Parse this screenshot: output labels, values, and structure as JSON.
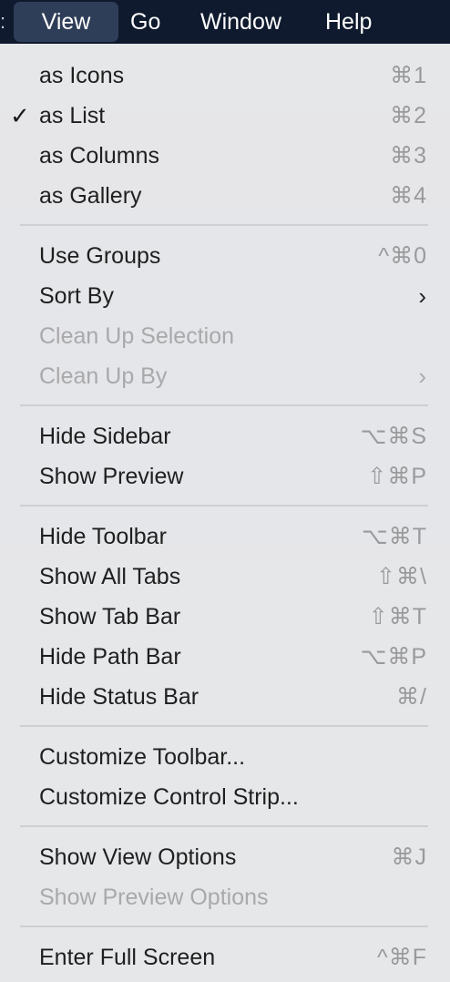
{
  "menubar": {
    "edge_glyph": ":",
    "items": [
      "View",
      "Go",
      "Window",
      "Help"
    ]
  },
  "menu": {
    "items": [
      {
        "label": "as Icons",
        "shortcut": "⌘1",
        "checked": false
      },
      {
        "label": "as List",
        "shortcut": "⌘2",
        "checked": true
      },
      {
        "label": "as Columns",
        "shortcut": "⌘3",
        "checked": false
      },
      {
        "label": "as Gallery",
        "shortcut": "⌘4",
        "checked": false
      },
      {
        "label": "Use Groups",
        "shortcut": "^⌘0"
      },
      {
        "label": "Sort By",
        "submenu": "›"
      },
      {
        "label": "Clean Up Selection",
        "disabled": true
      },
      {
        "label": "Clean Up By",
        "submenu": "›",
        "disabled": true
      },
      {
        "label": "Hide Sidebar",
        "shortcut": "⌥⌘S"
      },
      {
        "label": "Show Preview",
        "shortcut": "⇧⌘P"
      },
      {
        "label": "Hide Toolbar",
        "shortcut": "⌥⌘T"
      },
      {
        "label": "Show All Tabs",
        "shortcut": "⇧⌘\\"
      },
      {
        "label": "Show Tab Bar",
        "shortcut": "⇧⌘T"
      },
      {
        "label": "Hide Path Bar",
        "shortcut": "⌥⌘P"
      },
      {
        "label": "Hide Status Bar",
        "shortcut": "⌘/"
      },
      {
        "label": "Customize Toolbar..."
      },
      {
        "label": "Customize Control Strip..."
      },
      {
        "label": "Show View Options",
        "shortcut": "⌘J"
      },
      {
        "label": "Show Preview Options",
        "disabled": true
      },
      {
        "label": "Enter Full Screen",
        "shortcut": "^⌘F"
      }
    ],
    "check_glyph": "✓"
  }
}
